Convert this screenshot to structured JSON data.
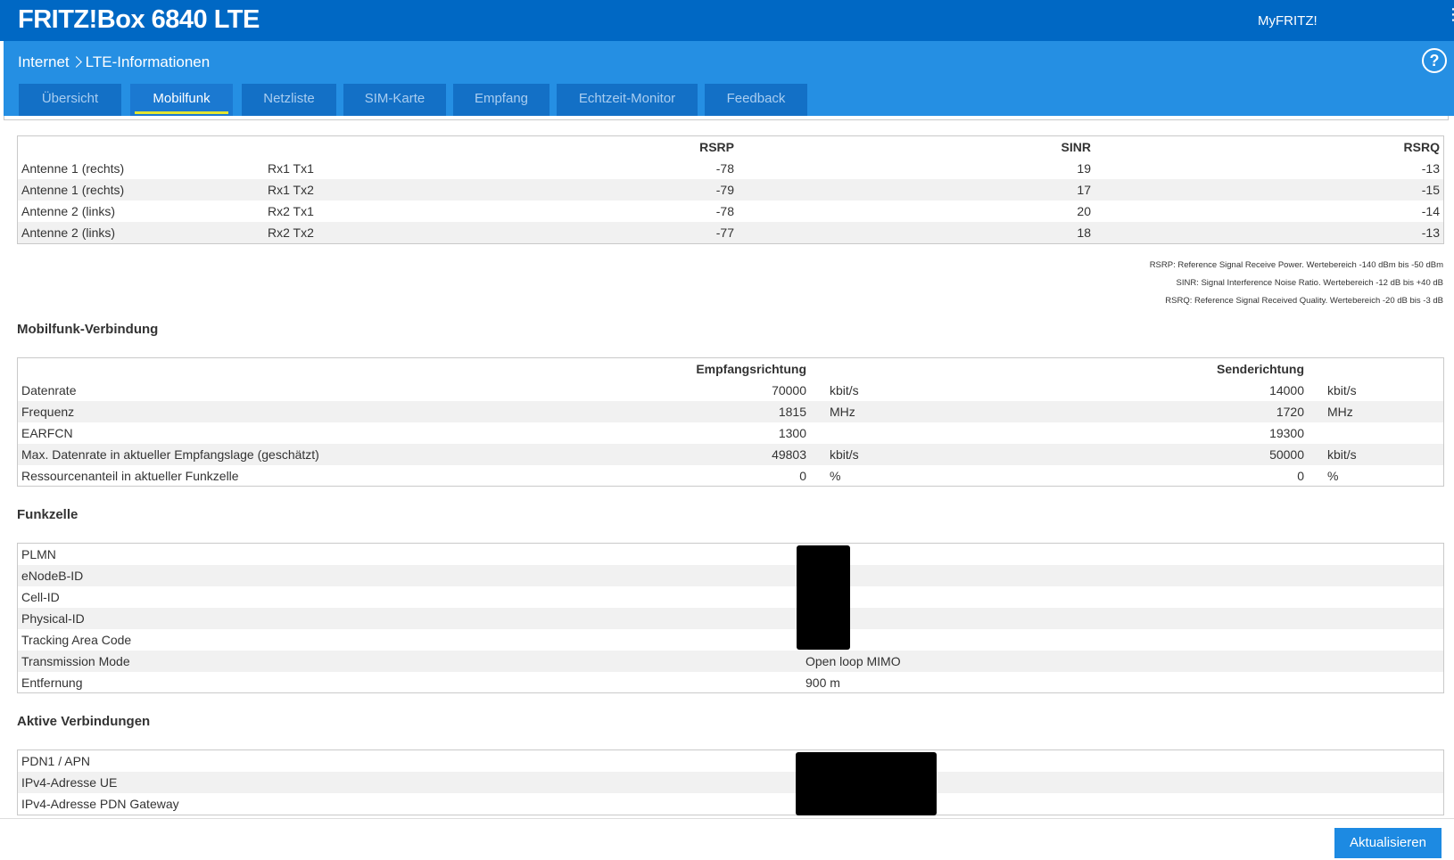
{
  "header": {
    "brand": "FRITZ!Box 6840 LTE",
    "myfritz": "MyFRITZ!",
    "breadcrumb_parent": "Internet",
    "breadcrumb_current": "LTE-Informationen",
    "help": "?"
  },
  "tabs": [
    {
      "label": "Übersicht"
    },
    {
      "label": "Mobilfunk"
    },
    {
      "label": "Netzliste"
    },
    {
      "label": "SIM-Karte"
    },
    {
      "label": "Empfang"
    },
    {
      "label": "Echtzeit-Monitor"
    },
    {
      "label": "Feedback"
    }
  ],
  "antennas": {
    "headers": {
      "rsrp": "RSRP",
      "sinr": "SINR",
      "rsrq": "RSRQ"
    },
    "rows": [
      {
        "antenna": "Antenne 1 (rechts)",
        "path": "Rx1 Tx1",
        "rsrp": "-78",
        "sinr": "19",
        "rsrq": "-13"
      },
      {
        "antenna": "Antenne 1 (rechts)",
        "path": "Rx1 Tx2",
        "rsrp": "-79",
        "sinr": "17",
        "rsrq": "-15"
      },
      {
        "antenna": "Antenne 2 (links)",
        "path": "Rx2 Tx1",
        "rsrp": "-78",
        "sinr": "20",
        "rsrq": "-14"
      },
      {
        "antenna": "Antenne 2 (links)",
        "path": "Rx2 Tx2",
        "rsrp": "-77",
        "sinr": "18",
        "rsrq": "-13"
      }
    ],
    "legend": [
      "RSRP: Reference Signal Receive Power. Wertebereich -140 dBm bis -50 dBm",
      "SINR: Signal Interference Noise Ratio. Wertebereich -12 dB bis +40 dB",
      "RSRQ: Reference Signal Received Quality. Wertebereich -20 dB bis -3 dB"
    ]
  },
  "mobilfunk": {
    "title": "Mobilfunk-Verbindung",
    "headers": {
      "down": "Empfangsrichtung",
      "up": "Senderichtung"
    },
    "rows": [
      {
        "label": "Datenrate",
        "down": "70000",
        "down_unit": "kbit/s",
        "up": "14000",
        "up_unit": "kbit/s"
      },
      {
        "label": "Frequenz",
        "down": "1815",
        "down_unit": "MHz",
        "up": "1720",
        "up_unit": "MHz"
      },
      {
        "label": "EARFCN",
        "down": "1300",
        "down_unit": "",
        "up": "19300",
        "up_unit": ""
      },
      {
        "label": "Max. Datenrate in aktueller Empfangslage (geschätzt)",
        "down": "49803",
        "down_unit": "kbit/s",
        "up": "50000",
        "up_unit": "kbit/s"
      },
      {
        "label": "Ressourcenanteil in aktueller Funkzelle",
        "down": "0",
        "down_unit": "%",
        "up": "0",
        "up_unit": "%"
      }
    ]
  },
  "funkzelle": {
    "title": "Funkzelle",
    "rows": [
      {
        "label": "PLMN",
        "value": ""
      },
      {
        "label": "eNodeB-ID",
        "value": ""
      },
      {
        "label": "Cell-ID",
        "value": ""
      },
      {
        "label": "Physical-ID",
        "value": ""
      },
      {
        "label": "Tracking Area Code",
        "value": ""
      },
      {
        "label": "Transmission Mode",
        "value": "Open loop MIMO"
      },
      {
        "label": "Entfernung",
        "value": "900 m"
      }
    ]
  },
  "aktive": {
    "title": "Aktive Verbindungen",
    "rows": [
      {
        "label": "PDN1 / APN",
        "value": ""
      },
      {
        "label": "IPv4-Adresse UE",
        "value": ""
      },
      {
        "label": "IPv4-Adresse PDN Gateway",
        "value": ""
      }
    ]
  },
  "footer": {
    "refresh_label": "Aktualisieren"
  }
}
